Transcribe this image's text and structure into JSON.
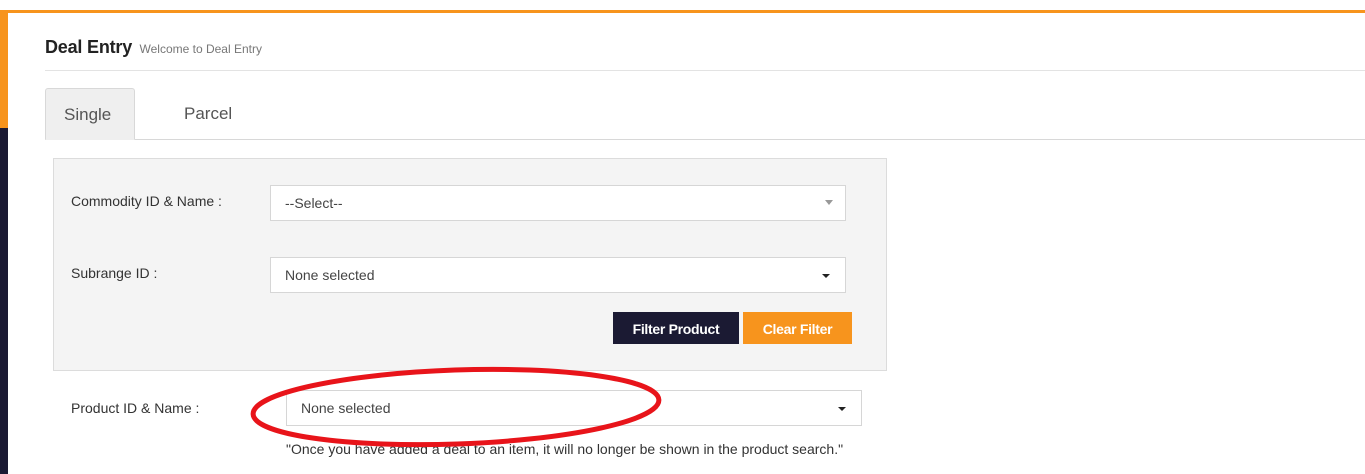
{
  "header": {
    "title": "Deal Entry",
    "subtitle": "Welcome to Deal Entry"
  },
  "tabs": [
    {
      "label": "Single",
      "active": true
    },
    {
      "label": "Parcel",
      "active": false
    }
  ],
  "filters": {
    "commodity": {
      "label": "Commodity ID & Name :",
      "value": "--Select--"
    },
    "subrange": {
      "label": "Subrange ID :",
      "value": "None selected"
    },
    "filter_button": "Filter Product",
    "clear_button": "Clear Filter"
  },
  "product": {
    "label": "Product ID & Name :",
    "value": "None selected"
  },
  "note": "\"Once you have added a deal to an item, it will no longer be shown in the product search.\"",
  "colors": {
    "accent": "#f7941d",
    "navy": "#1b1a33",
    "annotation": "#e8141a"
  }
}
